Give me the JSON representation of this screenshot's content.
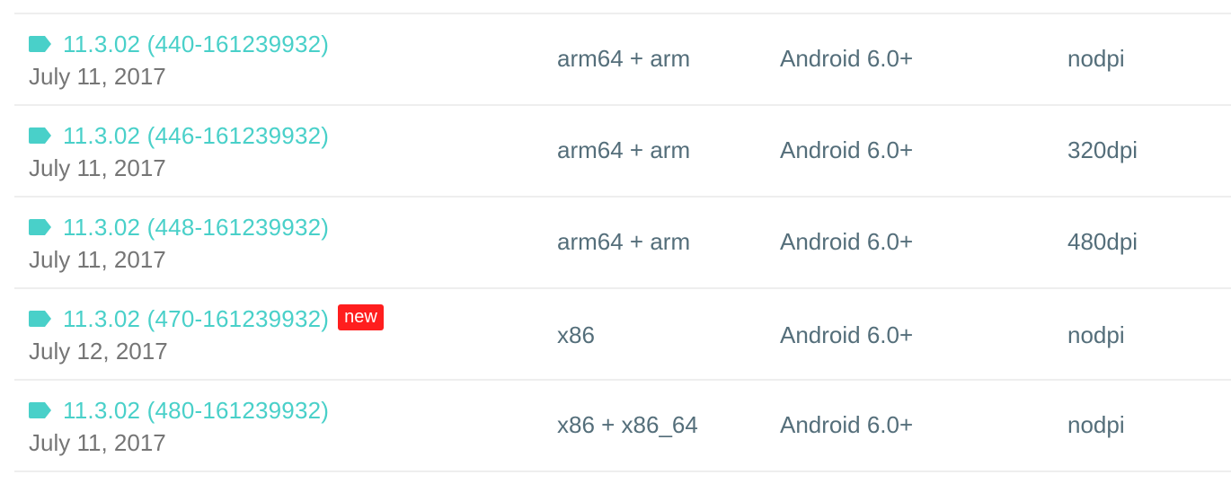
{
  "colors": {
    "accent": "#49d0c9",
    "new_badge": "#ff1e1e",
    "text_muted": "#757575",
    "text_cell": "#546e7a",
    "divider": "#eeeeee"
  },
  "icons": {
    "tag": "tag-icon"
  },
  "rows": [
    {
      "version": "11.3.02 (440-161239932)",
      "date": "July 11, 2017",
      "arch": "arm64 + arm",
      "min_android": "Android 6.0+",
      "dpi": "nodpi",
      "badge": ""
    },
    {
      "version": "11.3.02 (446-161239932)",
      "date": "July 11, 2017",
      "arch": "arm64 + arm",
      "min_android": "Android 6.0+",
      "dpi": "320dpi",
      "badge": ""
    },
    {
      "version": "11.3.02 (448-161239932)",
      "date": "July 11, 2017",
      "arch": "arm64 + arm",
      "min_android": "Android 6.0+",
      "dpi": "480dpi",
      "badge": ""
    },
    {
      "version": "11.3.02 (470-161239932)",
      "date": "July 12, 2017",
      "arch": "x86",
      "min_android": "Android 6.0+",
      "dpi": "nodpi",
      "badge": "new"
    },
    {
      "version": "11.3.02 (480-161239932)",
      "date": "July 11, 2017",
      "arch": "x86 + x86_64",
      "min_android": "Android 6.0+",
      "dpi": "nodpi",
      "badge": ""
    }
  ]
}
